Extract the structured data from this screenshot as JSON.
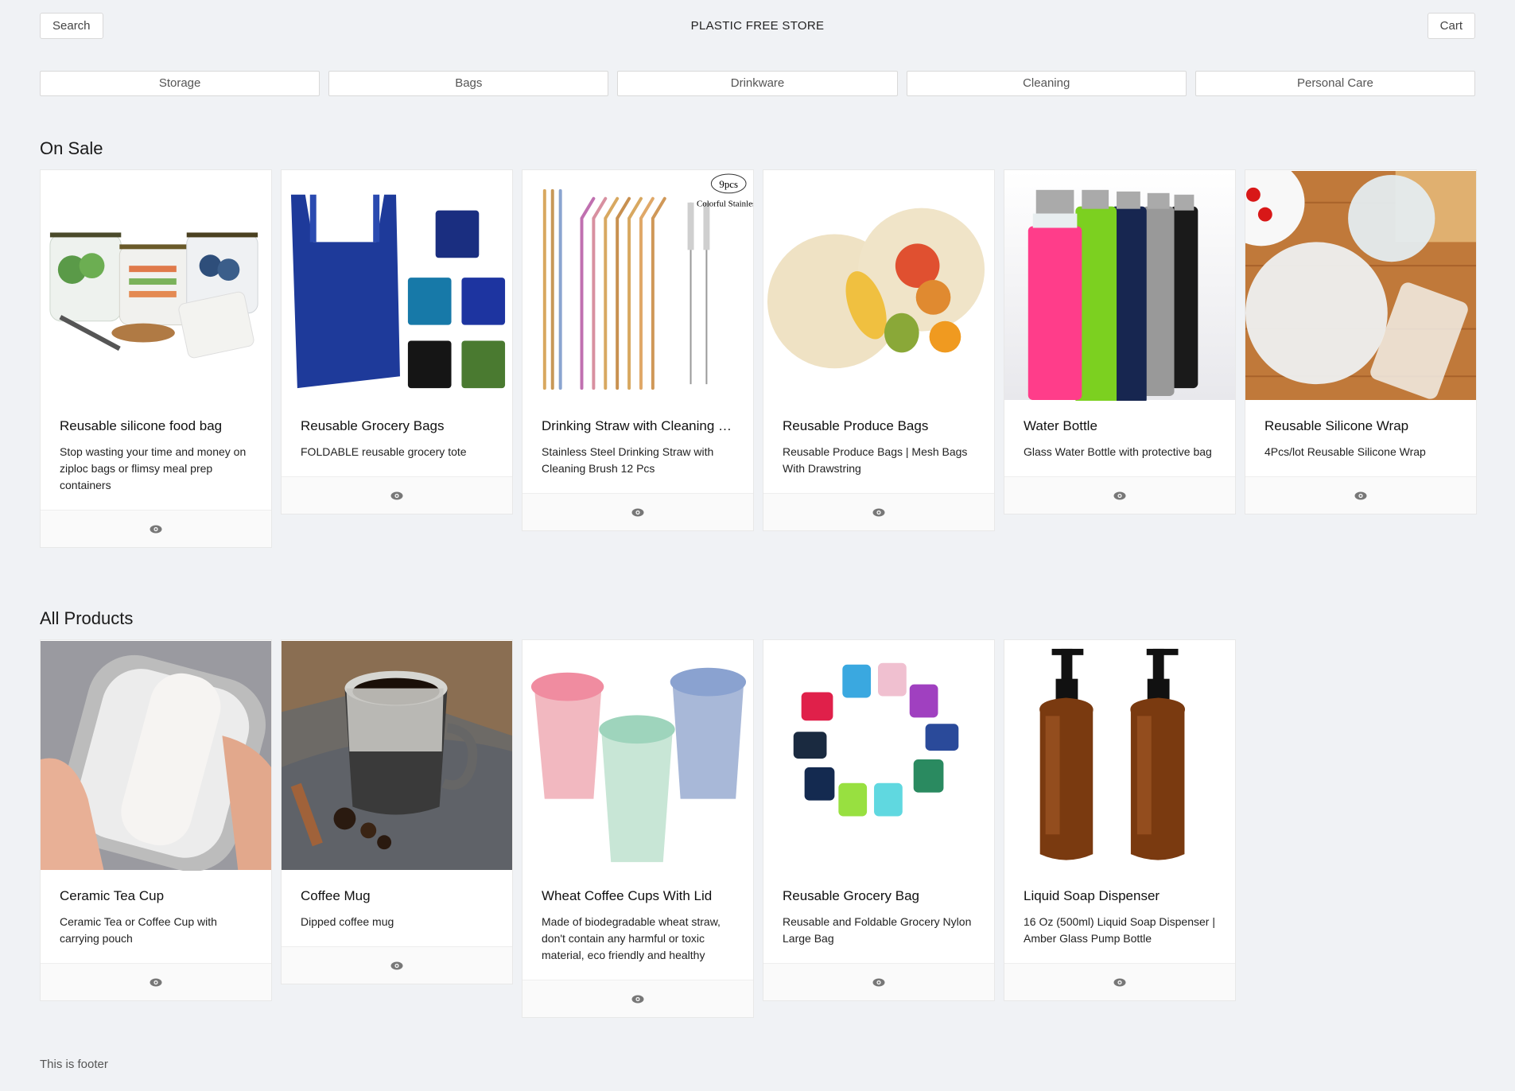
{
  "header": {
    "search_label": "Search",
    "brand": "PLASTIC FREE STORE",
    "cart_label": "Cart"
  },
  "categories": [
    "Storage",
    "Bags",
    "Drinkware",
    "Cleaning",
    "Personal Care"
  ],
  "on_sale": {
    "title": "On Sale",
    "products": [
      {
        "title": "Reusable silicone food bag",
        "desc": "Stop wasting your time and money on ziploc bags or flimsy meal prep containers"
      },
      {
        "title": "Reusable Grocery Bags",
        "desc": "FOLDABLE reusable grocery tote"
      },
      {
        "title": "Drinking Straw with Cleaning B...",
        "desc": "Stainless Steel Drinking Straw with Cleaning Brush 12 Pcs",
        "badge_top": "9pcs",
        "badge_text": "Colorful Stainless"
      },
      {
        "title": "Reusable Produce Bags",
        "desc": "Reusable Produce Bags | Mesh Bags With Drawstring"
      },
      {
        "title": "Water Bottle",
        "desc": "Glass Water Bottle with protective bag"
      },
      {
        "title": "Reusable Silicone Wrap",
        "desc": "4Pcs/lot Reusable Silicone Wrap"
      }
    ]
  },
  "all_products": {
    "title": "All Products",
    "products": [
      {
        "title": "Ceramic Tea Cup",
        "desc": "Ceramic Tea or Coffee Cup with carrying pouch"
      },
      {
        "title": "Coffee Mug",
        "desc": "Dipped coffee mug"
      },
      {
        "title": "Wheat Coffee Cups With Lid",
        "desc": "Made of biodegradable wheat straw, don't contain any harmful or toxic material, eco friendly and healthy"
      },
      {
        "title": "Reusable Grocery Bag",
        "desc": "Reusable and Foldable Grocery Nylon Large Bag"
      },
      {
        "title": "Liquid Soap Dispenser",
        "desc": "16 Oz (500ml) Liquid Soap Dispenser | Amber Glass Pump Bottle"
      }
    ]
  },
  "footer": {
    "text": "This is footer"
  },
  "icons": {
    "view": "eye-icon"
  }
}
